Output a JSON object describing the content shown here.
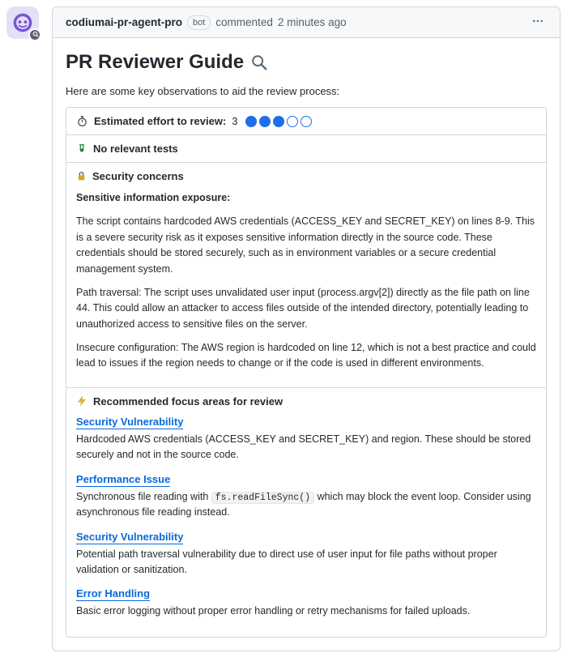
{
  "header": {
    "author": "codiumai-pr-agent-pro",
    "bot_label": "bot",
    "action": "commented",
    "timestamp": "2 minutes ago"
  },
  "title": "PR Reviewer Guide",
  "intro": "Here are some key observations to aid the review process:",
  "effort": {
    "label": "Estimated effort to review:",
    "value": "3",
    "max": 5,
    "filled": 3
  },
  "tests": {
    "label": "No relevant tests"
  },
  "security": {
    "label": "Security concerns",
    "subhead": "Sensitive information exposure:",
    "p1": "The script contains hardcoded AWS credentials (ACCESS_KEY and SECRET_KEY) on lines 8-9. This is a severe security risk as it exposes sensitive information directly in the source code. These credentials should be stored securely, such as in environment variables or a secure credential management system.",
    "p2": "Path traversal: The script uses unvalidated user input (process.argv[2]) directly as the file path on line 44. This could allow an attacker to access files outside of the intended directory, potentially leading to unauthorized access to sensitive files on the server.",
    "p3": "Insecure configuration: The AWS region is hardcoded on line 12, which is not a best practice and could lead to issues if the region needs to change or if the code is used in different environments."
  },
  "focus": {
    "label": "Recommended focus areas for review",
    "items": [
      {
        "title": "Security Vulnerability",
        "desc": "Hardcoded AWS credentials (ACCESS_KEY and SECRET_KEY) and region. These should be stored securely and not in the source code."
      },
      {
        "title": "Performance Issue",
        "desc_pre": "Synchronous file reading with ",
        "code": "fs.readFileSync()",
        "desc_post": " which may block the event loop. Consider using asynchronous file reading instead."
      },
      {
        "title": "Security Vulnerability",
        "desc": "Potential path traversal vulnerability due to direct use of user input for file paths without proper validation or sanitization."
      },
      {
        "title": "Error Handling",
        "desc": "Basic error logging without proper error handling or retry mechanisms for failed uploads."
      }
    ]
  },
  "icons": {
    "magnifier": "magnifier-icon",
    "stopwatch": "stopwatch-icon",
    "test_tube": "test-tube-icon",
    "lock": "lock-icon",
    "bolt": "bolt-icon"
  }
}
